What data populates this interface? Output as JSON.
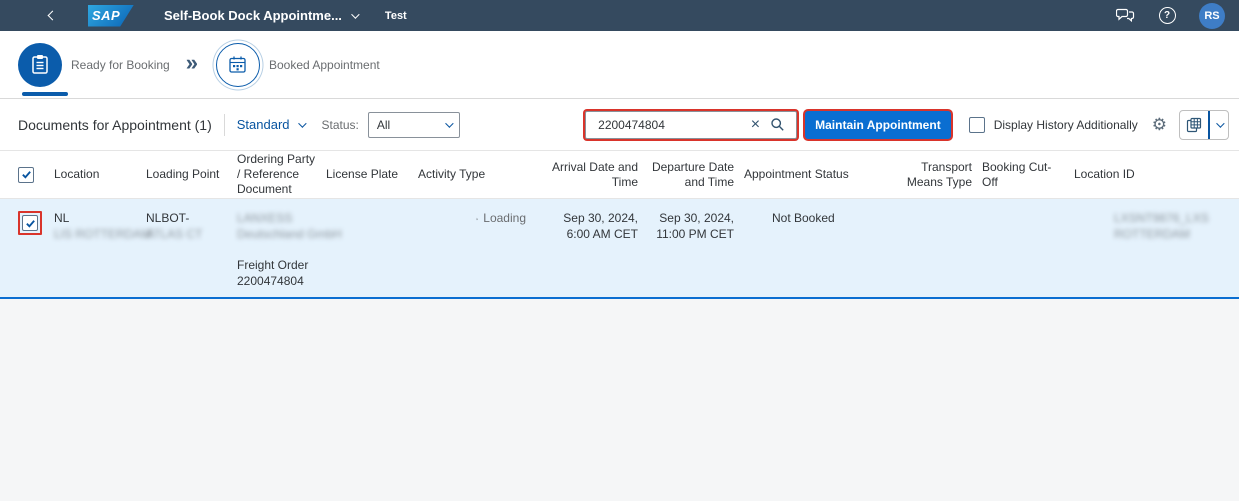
{
  "colors": {
    "shell_bg": "#354a5f",
    "accent": "#0854a0",
    "button_blue": "#0a6ed1",
    "annotation_red": "#d9342b",
    "row_selected_bg": "#e5f2fc",
    "row_border": "#0a6ed1",
    "text_dark": "#32363a",
    "text_gray": "#6a6d70",
    "page_bg": "#f5f6f7",
    "border_gray": "#e5e5e5",
    "control_border": "#89919a",
    "avatar_bg": "#3e7dc6",
    "icon_dark": "#32536f",
    "step_circle_blue": "#0b5cab"
  },
  "icons": {
    "help_glyph": "?",
    "double_chevron": "»",
    "gear_glyph": "⚙",
    "clear_glyph": "×"
  },
  "shell": {
    "logo_text": "SAP",
    "title": "Self-Book Dock Appointme...",
    "system_tag": "Test",
    "avatar_initials": "RS"
  },
  "process_flow": {
    "steps": [
      {
        "label": "Ready for Booking",
        "selected": true
      },
      {
        "label": "Booked Appointment",
        "selected": false
      }
    ]
  },
  "toolbar": {
    "title": "Documents for Appointment (1)",
    "variant_label": "Standard",
    "status_label": "Status:",
    "status_value": "All",
    "search_value": "2200474804",
    "maintain_button_label": "Maintain Appointment",
    "history_checkbox_label": "Display History Additionally"
  },
  "table": {
    "columns": [
      {
        "label": "Location",
        "align": "left"
      },
      {
        "label": "Loading Point",
        "align": "left"
      },
      {
        "label": "Ordering Party / Reference Document",
        "align": "left"
      },
      {
        "label": "License Plate",
        "align": "left"
      },
      {
        "label": "Activity Type",
        "align": "left"
      },
      {
        "label": "Arrival Date and Time",
        "align": "right"
      },
      {
        "label": "Departure Date and Time",
        "align": "right"
      },
      {
        "label": "Appointment Status",
        "align": "left"
      },
      {
        "label": "Transport Means Type",
        "align": "right"
      },
      {
        "label": "Booking Cut-Off",
        "align": "left"
      },
      {
        "label": "Location ID",
        "align": "left"
      }
    ],
    "row": {
      "selected": true,
      "location_prefix": "NL",
      "location_redacted": "LIS ROTTERDAM",
      "loading_point_prefix": "NLBOT-",
      "loading_point_redacted": "ATLAS CT",
      "ordering_party_redacted_line1": "LANXESS",
      "ordering_party_redacted_line2": "Deutschland GmbH",
      "reference_document_type": "Freight Order",
      "reference_document_number": "2200474804",
      "license_plate": "",
      "activity_type": "Loading",
      "arrival_line1": "Sep 30, 2024,",
      "arrival_line2": "6:00 AM CET",
      "departure_line1": "Sep 30, 2024,",
      "departure_line2": "11:00 PM CET",
      "appointment_status": "Not Booked",
      "transport_means_type": "",
      "booking_cutoff": "",
      "location_id_redacted_line1": "LXSNT9876_LXS",
      "location_id_redacted_line2": "ROTTERDAM"
    }
  }
}
